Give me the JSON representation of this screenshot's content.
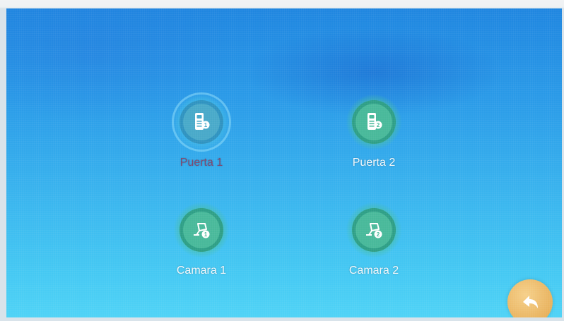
{
  "menu": {
    "items": [
      {
        "label": "Puerta 1",
        "icon": "door-station-1-icon",
        "selected": true
      },
      {
        "label": "Puerta 2",
        "icon": "door-station-2-icon",
        "selected": false
      },
      {
        "label": "Camara 1",
        "icon": "camera-1-icon",
        "selected": false
      },
      {
        "label": "Camara 2",
        "icon": "camera-2-icon",
        "selected": false
      }
    ]
  },
  "back_button": {
    "icon": "back-arrow-icon"
  },
  "colors": {
    "background_top": "#1f86e0",
    "background_bottom": "#4fd3f6",
    "icon_green": "#48b99a",
    "icon_selected": "#48a9c9",
    "selected_label": "#7a4770",
    "back_button": "#e8b25d"
  }
}
